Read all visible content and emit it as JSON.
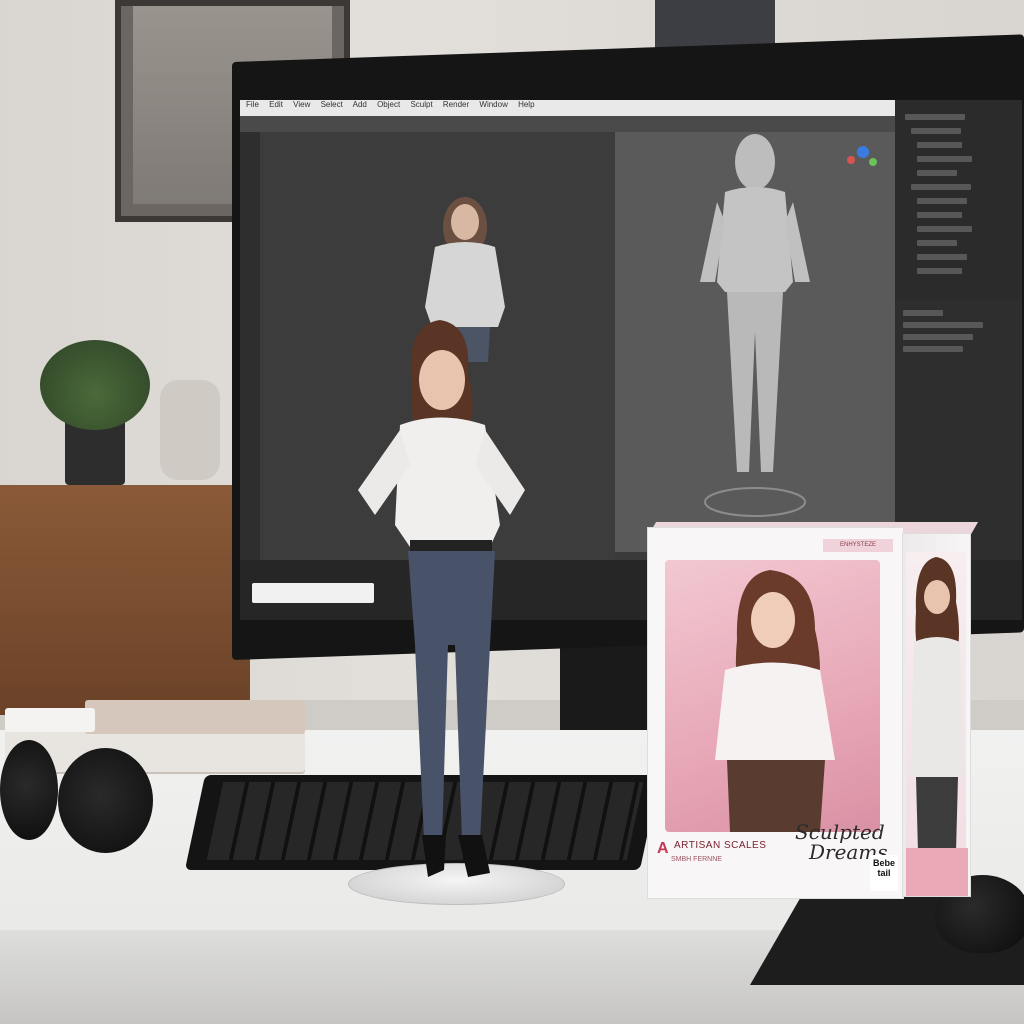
{
  "scene": {
    "description_hidden": "",
    "box": {
      "badge": "ENHYSTEZE",
      "brand_title_line1": "Sculpted",
      "brand_title_line2": "Dreams",
      "maker_name": "ARTISAN SCALES",
      "maker_sub": "SMBH FERNNE",
      "logo": "A",
      "barcode_label": "Bebe tail"
    },
    "monitor": {
      "menu_items": [
        "File",
        "Edit",
        "View",
        "Select",
        "Add",
        "Object",
        "Sculpt",
        "Render",
        "Window",
        "Help"
      ]
    }
  },
  "colors": {
    "box_pink": "#e7a7b6",
    "desk": "#f1f1f0",
    "monitor_bezel": "#151515"
  }
}
